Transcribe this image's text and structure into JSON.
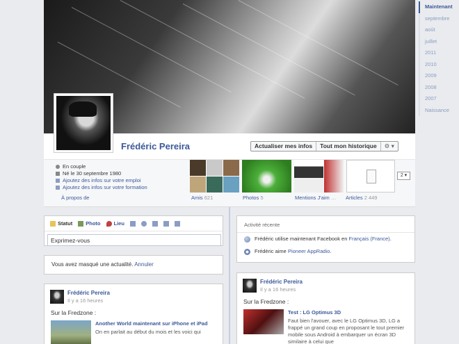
{
  "profile": {
    "name": "Frédéric Pereira",
    "update_info_label": "Actualiser mes infos",
    "history_label": "Tout mon historique",
    "gear_label": "⚙ ▾"
  },
  "info": {
    "relationship": "En couple",
    "birth": "Né le 30 septembre 1980",
    "add_job": "Ajoutez des infos sur votre emploi",
    "add_education": "Ajoutez des infos sur votre formation",
    "about_link": "À propos de"
  },
  "tiles": {
    "friends_label": "Amis",
    "friends_count": "621",
    "photos_label": "Photos",
    "photos_count": "5",
    "mentions_label": "Mentions J'aim",
    "mentions_more": "…",
    "articles_label": "Articles",
    "articles_count": "2 449",
    "dropdown_value": "2 ▾"
  },
  "timeline_nav": [
    "Maintenant",
    "septembre",
    "août",
    "juillet",
    "2011",
    "2010",
    "2009",
    "2008",
    "2007",
    "Naissance"
  ],
  "composer": {
    "tabs": [
      "Statut",
      "Photo",
      "Lieu"
    ],
    "placeholder": "Exprimez-vous"
  },
  "hidden_notice": {
    "text": "Vous avez masqué une actualité.",
    "undo": "Annuler"
  },
  "recent": {
    "title": "Activité récente",
    "item1_pre": "Frédéric utilise maintenant Facebook en ",
    "item1_link": "Français (France)",
    "item1_post": ".",
    "item2_pre": "Frédéric aime ",
    "item2_link": "Pioneer AppRadio",
    "item2_post": "."
  },
  "post_left": {
    "author": "Frédéric Pereira",
    "time": "Il y a 16 heures",
    "text": "Sur la Fredzone :",
    "share_title": "Another World maintenant sur iPhone et iPad",
    "share_desc": "On en parlait au début du mois et les voici qui"
  },
  "post_right": {
    "author": "Frédéric Pereira",
    "time": "Il y a 16 heures",
    "text": "Sur la Fredzone :",
    "share_title": "Test : LG Optimus 3D",
    "share_desc": "Faut bien l'avouer, avec le LG Optimus 3D, LG a frappé un grand coup en proposant le tout premier mobile sous Android à embarquer un écran 3D similaire à celui que"
  }
}
